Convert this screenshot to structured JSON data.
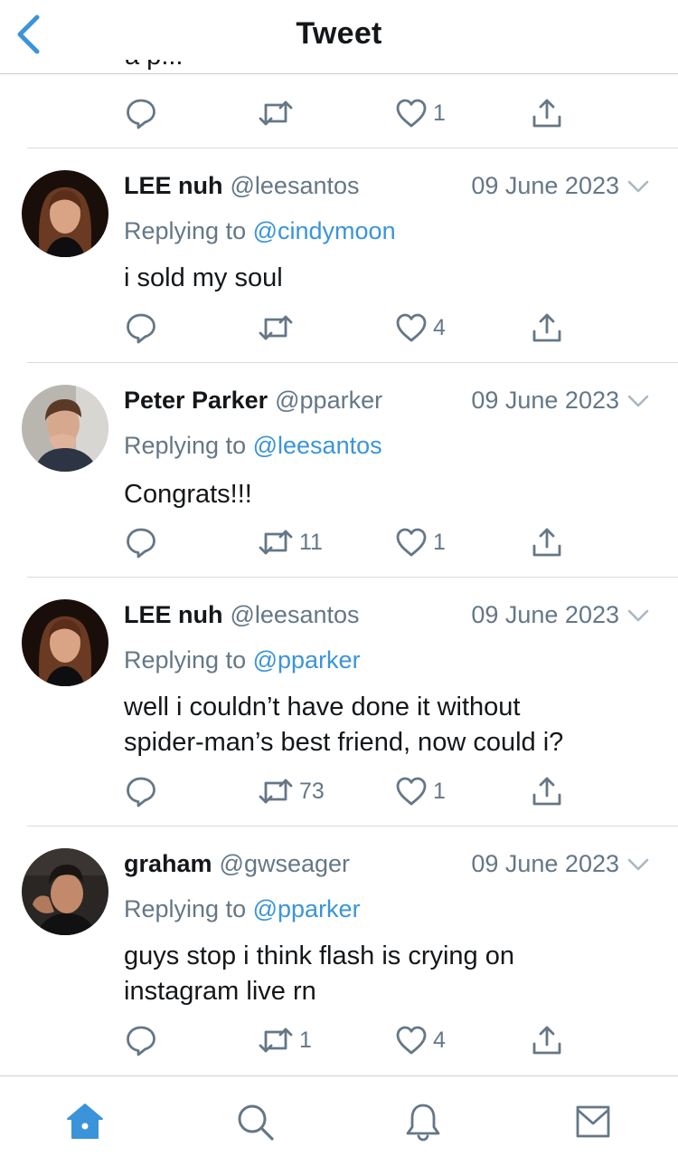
{
  "header": {
    "title": "Tweet"
  },
  "top_tweet": {
    "partial_text": "a p...",
    "likes": "1"
  },
  "tweets": [
    {
      "name": "LEE nuh",
      "handle": "@leesantos",
      "date": "09 June 2023",
      "replying_prefix": "Replying to",
      "replying_to": "@cindymoon",
      "text": "i sold my soul",
      "retweets": "",
      "likes": "4"
    },
    {
      "name": "Peter Parker",
      "handle": "@pparker",
      "date": "09 June 2023",
      "replying_prefix": "Replying to",
      "replying_to": "@leesantos",
      "text": "Congrats!!!",
      "retweets": "11",
      "likes": "1"
    },
    {
      "name": "LEE nuh",
      "handle": "@leesantos",
      "date": "09 June 2023",
      "replying_prefix": "Replying to",
      "replying_to": "@pparker",
      "text_line1": "well i couldn’t have done it without",
      "text_line2": "spider-man’s best friend, now could i?",
      "retweets": "73",
      "likes": "1"
    },
    {
      "name": "graham",
      "handle": "@gwseager",
      "date": "09 June 2023",
      "replying_prefix": "Replying to",
      "replying_to": "@pparker",
      "text_line1": "guys stop i think flash is crying on",
      "text_line2": "instagram live rn",
      "retweets": "1",
      "likes": "4"
    }
  ],
  "colors": {
    "accent": "#3b94d9",
    "muted": "#657786",
    "text": "#14171a",
    "divider": "#d6dadd"
  },
  "icons": {
    "back": "chevron-left-icon",
    "reply": "reply-icon",
    "retweet": "retweet-icon",
    "like": "heart-icon",
    "share": "share-icon",
    "home": "home-icon",
    "search": "search-icon",
    "notifications": "bell-icon",
    "messages": "mail-icon"
  }
}
